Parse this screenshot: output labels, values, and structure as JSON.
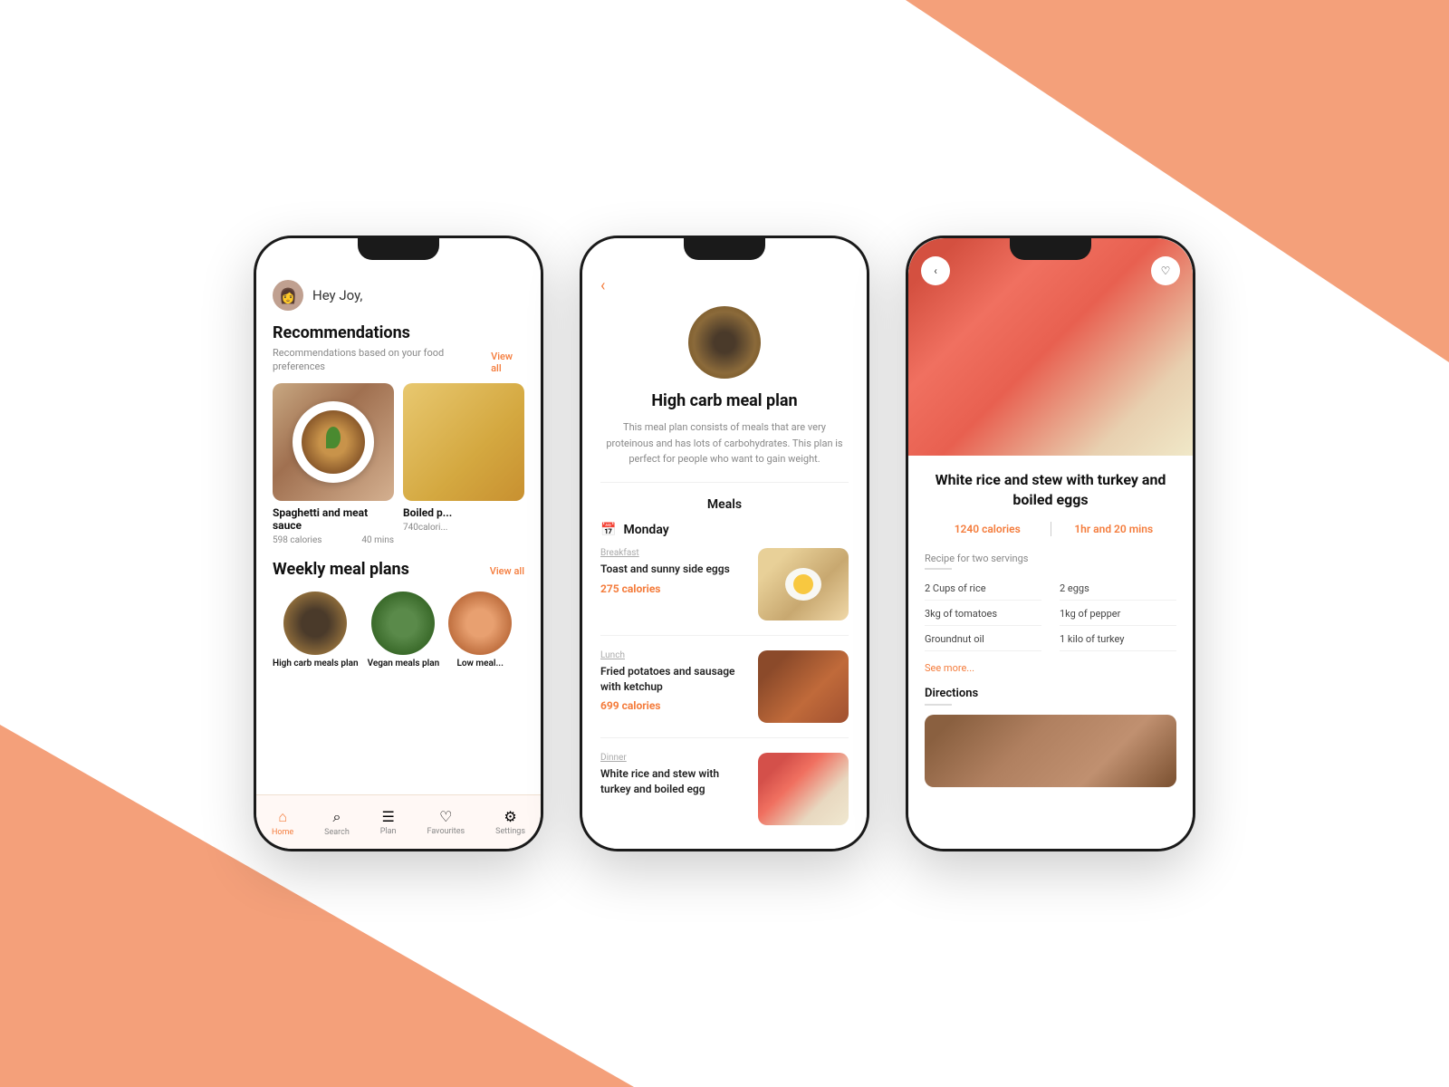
{
  "background": {
    "accent_color": "#f4a07a"
  },
  "phone1": {
    "greeting": "Hey Joy,",
    "recommendations": {
      "title": "Recommendations",
      "subtitle": "Recommendations based on your food preferences",
      "view_all": "View all",
      "cards": [
        {
          "name": "Spaghetti and meat sauce",
          "calories": "598 calories",
          "time": "40 mins",
          "type": "spaghetti"
        },
        {
          "name": "Boiled p...",
          "calories": "740calori...",
          "type": "boiled"
        }
      ]
    },
    "weekly_meal_plans": {
      "title": "Weekly meal plans",
      "view_all": "View all",
      "plans": [
        {
          "name": "High carb meals plan",
          "type": "high-carb"
        },
        {
          "name": "Vegan meals plan",
          "type": "vegan"
        },
        {
          "name": "Low meal...",
          "type": "low"
        }
      ]
    },
    "nav": {
      "items": [
        {
          "label": "Home",
          "icon": "🏠",
          "active": true
        },
        {
          "label": "Search",
          "icon": "🔍",
          "active": false
        },
        {
          "label": "Plan",
          "icon": "📋",
          "active": false
        },
        {
          "label": "Favourites",
          "icon": "🤍",
          "active": false
        },
        {
          "label": "Settings",
          "icon": "⚙️",
          "active": false
        }
      ]
    }
  },
  "phone2": {
    "back_icon": "‹",
    "title": "High carb meal plan",
    "description": "This meal plan consists of meals that are very proteinous and has lots of carbohydrates. This plan is perfect for people who want to gain weight.",
    "meals_label": "Meals",
    "day": "Monday",
    "breakfast": {
      "type": "Breakfast",
      "name": "Toast and sunny side eggs",
      "calories": "275 calories"
    },
    "lunch": {
      "type": "Lunch",
      "name": "Fried potatoes and sausage with ketchup",
      "calories": "699 calories"
    },
    "dinner": {
      "type": "Dinner",
      "name": "White rice and stew with turkey and boiled egg",
      "calories": ""
    }
  },
  "phone3": {
    "back_icon": "‹",
    "heart_icon": "♡",
    "title": "White rice and stew with turkey and boiled eggs",
    "calories": "1240 calories",
    "time": "1hr and 20 mins",
    "servings_label": "Recipe for two servings",
    "ingredients": [
      {
        "item": "2 Cups of rice"
      },
      {
        "item": "2 eggs"
      },
      {
        "item": "3kg of tomatoes"
      },
      {
        "item": "1kg of pepper"
      },
      {
        "item": "Groundnut oil"
      },
      {
        "item": "1 kilo of turkey"
      }
    ],
    "see_more": "See more...",
    "directions_label": "Directions"
  }
}
